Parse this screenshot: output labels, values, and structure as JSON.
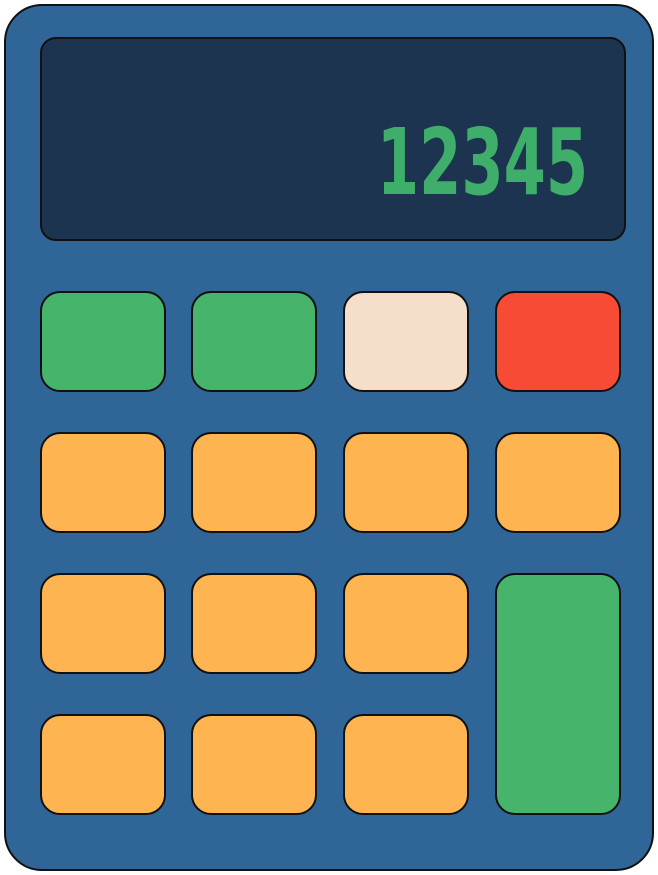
{
  "display": {
    "value": "12345",
    "text_color": "#3fae6a",
    "background": "#1c3450"
  },
  "body_color": "#2f6597",
  "keys": [
    {
      "name": "key-r1-c1",
      "color": "#47b46b"
    },
    {
      "name": "key-r1-c2",
      "color": "#47b46b"
    },
    {
      "name": "key-r1-c3",
      "color": "#f5dfca"
    },
    {
      "name": "key-r1-c4",
      "color": "#f84b35"
    },
    {
      "name": "key-r2-c1",
      "color": "#fdb451"
    },
    {
      "name": "key-r2-c2",
      "color": "#fdb451"
    },
    {
      "name": "key-r2-c3",
      "color": "#fdb451"
    },
    {
      "name": "key-r2-c4",
      "color": "#fdb451"
    },
    {
      "name": "key-r3-c1",
      "color": "#fdb451"
    },
    {
      "name": "key-r3-c2",
      "color": "#fdb451"
    },
    {
      "name": "key-r3-c3",
      "color": "#fdb451"
    },
    {
      "name": "key-tall-r3-c4",
      "color": "#47b46b"
    },
    {
      "name": "key-r4-c1",
      "color": "#fdb451"
    },
    {
      "name": "key-r4-c2",
      "color": "#fdb451"
    },
    {
      "name": "key-r4-c3",
      "color": "#fdb451"
    }
  ]
}
